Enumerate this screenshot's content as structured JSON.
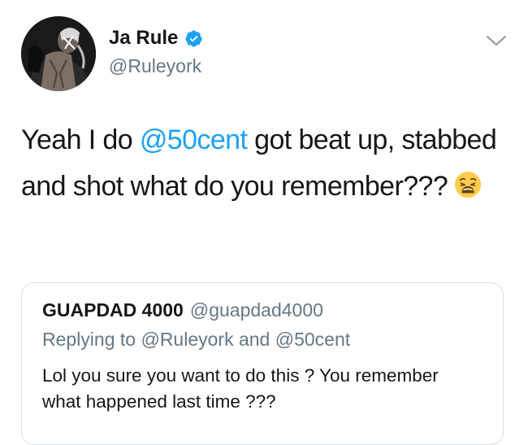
{
  "tweet": {
    "author": {
      "display_name": "Ja Rule",
      "handle": "@Ruleyork",
      "verified": true,
      "avatar_icon": "avatar-photo"
    },
    "text_parts": {
      "p1": "Yeah I do ",
      "mention": "@50cent",
      "p2": " got beat up, stabbed and shot what do you remember???"
    },
    "emoji": "weary-face"
  },
  "quoted_tweet": {
    "author_name": "GUAPDAD 4000",
    "author_handle": "@guapdad4000",
    "replying_prefix": "Replying to ",
    "reply_mention_1": "@Ruleyork",
    "reply_and": " and ",
    "reply_mention_2": "@50cent",
    "text": "Lol you sure you want to do this ? You remember what happened last time ???"
  },
  "colors": {
    "link": "#1da1f2",
    "secondary_text": "#657786",
    "primary_text": "#14171a",
    "border": "#d9dfe4"
  }
}
